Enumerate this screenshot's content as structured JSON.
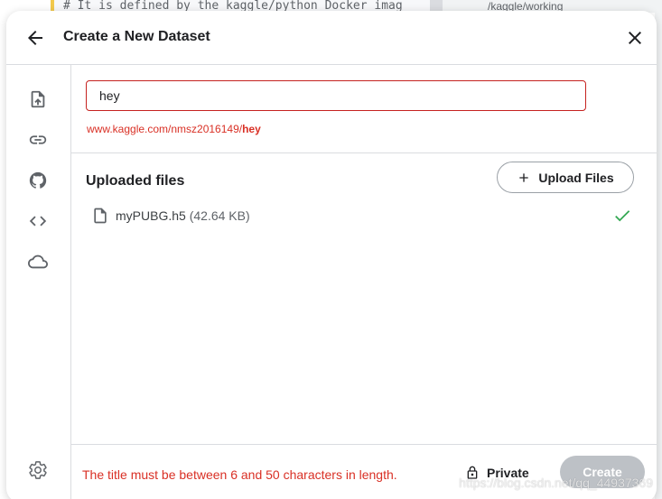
{
  "background": {
    "code_line": "# It is defined by the kaggle/python Docker imag",
    "path_text": "/kaggle/working"
  },
  "modal": {
    "title": "Create a New Dataset",
    "dataset_title_value": "hey",
    "url_prefix": "www.kaggle.com/nmsz2016149/",
    "url_slug": "hey",
    "uploaded_files_heading": "Uploaded files",
    "upload_button_label": "Upload Files",
    "files": [
      {
        "name": "myPUBG.h5",
        "size": "(42.64 KB)",
        "status": "uploaded"
      }
    ],
    "error_message": "The title must be between 6 and 50 characters in length.",
    "visibility_label": "Private",
    "create_button_label": "Create"
  },
  "side_rail": {
    "icons": [
      "upload-icon",
      "link-icon",
      "github-icon",
      "code-icon",
      "cloud-icon",
      "settings-icon"
    ]
  },
  "watermark": "https://blog.csdn.net/qq_44937369",
  "colors": {
    "error": "#d93025",
    "success": "#34a853",
    "disabled_button": "#bdc1c6",
    "text": "#202124"
  }
}
